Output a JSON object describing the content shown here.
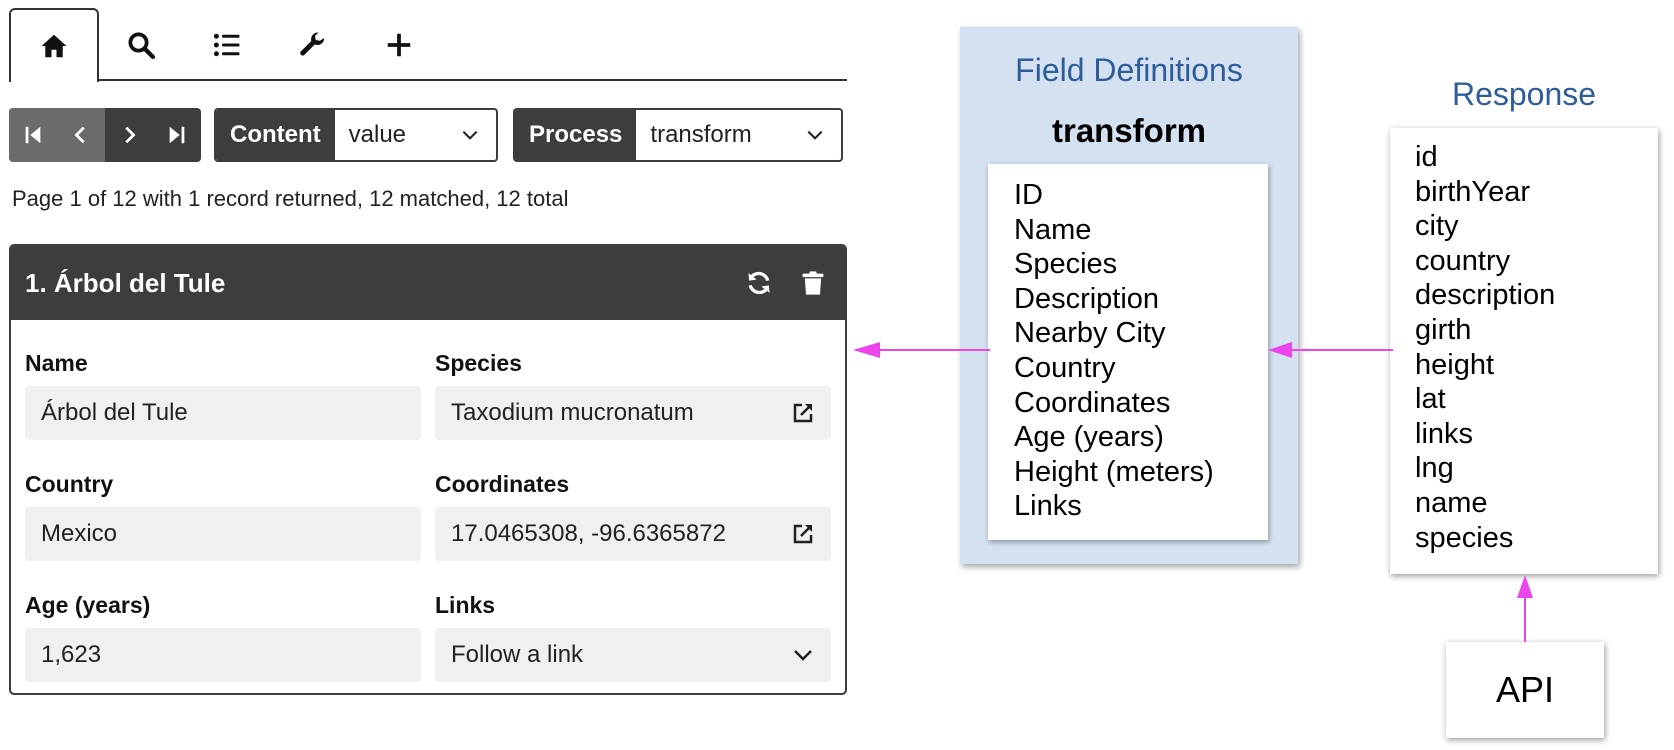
{
  "tabs": [
    {
      "icon": "home-icon",
      "active": true
    },
    {
      "icon": "search-icon",
      "active": false
    },
    {
      "icon": "list-icon",
      "active": false
    },
    {
      "icon": "wrench-icon",
      "active": false
    },
    {
      "icon": "plus-icon",
      "active": false
    }
  ],
  "toolbar": {
    "content_label": "Content",
    "content_value": "value",
    "process_label": "Process",
    "process_value": "transform"
  },
  "status": "Page 1 of 12 with 1 record returned, 12 matched, 12 total",
  "record": {
    "title": "1. Árbol del Tule",
    "fields": {
      "name_label": "Name",
      "name_value": "Árbol del Tule",
      "species_label": "Species",
      "species_value": "Taxodium mucronatum",
      "country_label": "Country",
      "country_value": "Mexico",
      "coordinates_label": "Coordinates",
      "coordinates_value": "17.0465308, -96.6365872",
      "age_label": "Age (years)",
      "age_value": "1,623",
      "links_label": "Links",
      "links_value": "Follow a link"
    }
  },
  "diagram": {
    "field_definitions": {
      "title": "Field Definitions",
      "subtitle": "transform",
      "items": [
        "ID",
        "Name",
        "Species",
        "Description",
        "Nearby City",
        "Country",
        "Coordinates",
        "Age (years)",
        "Height (meters)",
        "Links"
      ]
    },
    "response": {
      "title": "Response",
      "items": [
        "id",
        "birthYear",
        "city",
        "country",
        "description",
        "girth",
        "height",
        "lat",
        "links",
        "lng",
        "name",
        "species"
      ]
    },
    "api_label": "API",
    "colors": {
      "arrow": "#ee44ee",
      "panel_bg": "#d3e1f0",
      "title_blue": "#2f5c9a",
      "dark": "#3d3d3d"
    }
  }
}
